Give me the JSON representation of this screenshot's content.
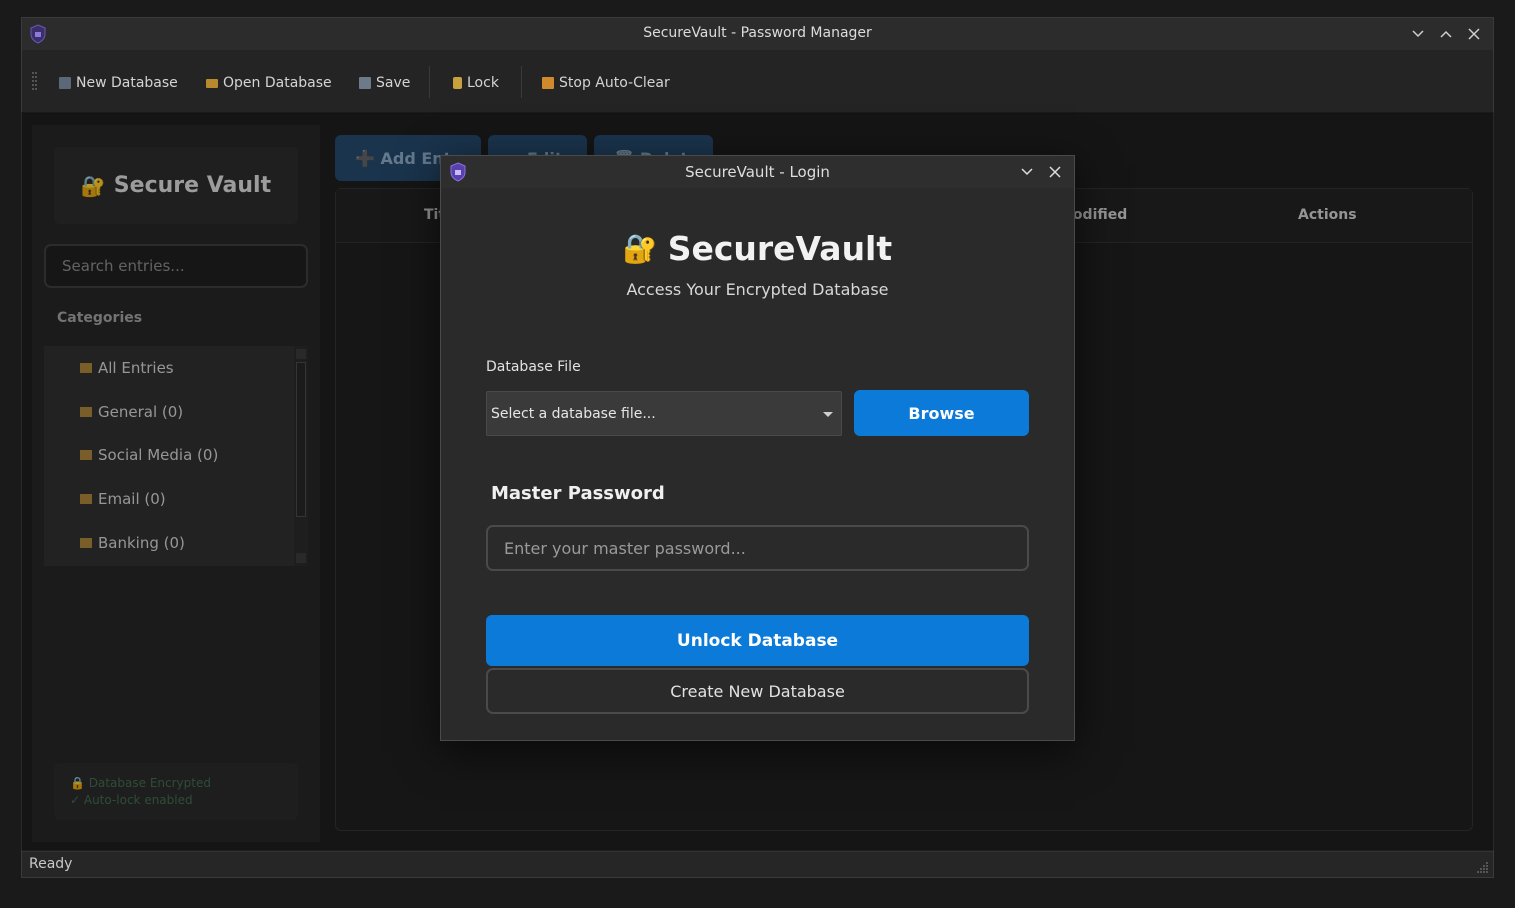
{
  "window": {
    "title": "SecureVault - Password Manager"
  },
  "toolbar": {
    "new_database": "New Database",
    "open_database": "Open Database",
    "save": "Save",
    "lock": "Lock",
    "stop_auto_clear": "Stop Auto-Clear"
  },
  "sidebar": {
    "brand": "Secure Vault",
    "brand_icon": "lock-key-icon",
    "search_placeholder": "Search entries...",
    "categories_title": "Categories",
    "categories": [
      {
        "label": "All Entries"
      },
      {
        "label": "General (0)"
      },
      {
        "label": "Social Media (0)"
      },
      {
        "label": "Email (0)"
      },
      {
        "label": "Banking (0)"
      }
    ],
    "status_lines": [
      "🔒 Database Encrypted",
      "✓ Auto-lock enabled"
    ]
  },
  "main": {
    "actions": {
      "add": "➕ Add Entry",
      "edit": "✏ Edit",
      "delete": "🗑 Delete"
    },
    "columns": {
      "title": "Title",
      "modified": "Modified",
      "actions": "Actions"
    }
  },
  "statusbar": {
    "text": "Ready"
  },
  "dialog": {
    "title": "SecureVault - Login",
    "heading": "SecureVault",
    "subtitle": "Access Your Encrypted Database",
    "database_file_label": "Database File",
    "database_file_value": "Select a database file...",
    "browse": "Browse",
    "master_password_label": "Master Password",
    "master_password_placeholder": "Enter your master password...",
    "unlock": "Unlock Database",
    "create": "Create New Database"
  },
  "colors": {
    "accent": "#0b7ad9",
    "background": "#1e1e1e",
    "dialog_bg": "#2a2a2a",
    "status_green": "#3f6b4e"
  }
}
